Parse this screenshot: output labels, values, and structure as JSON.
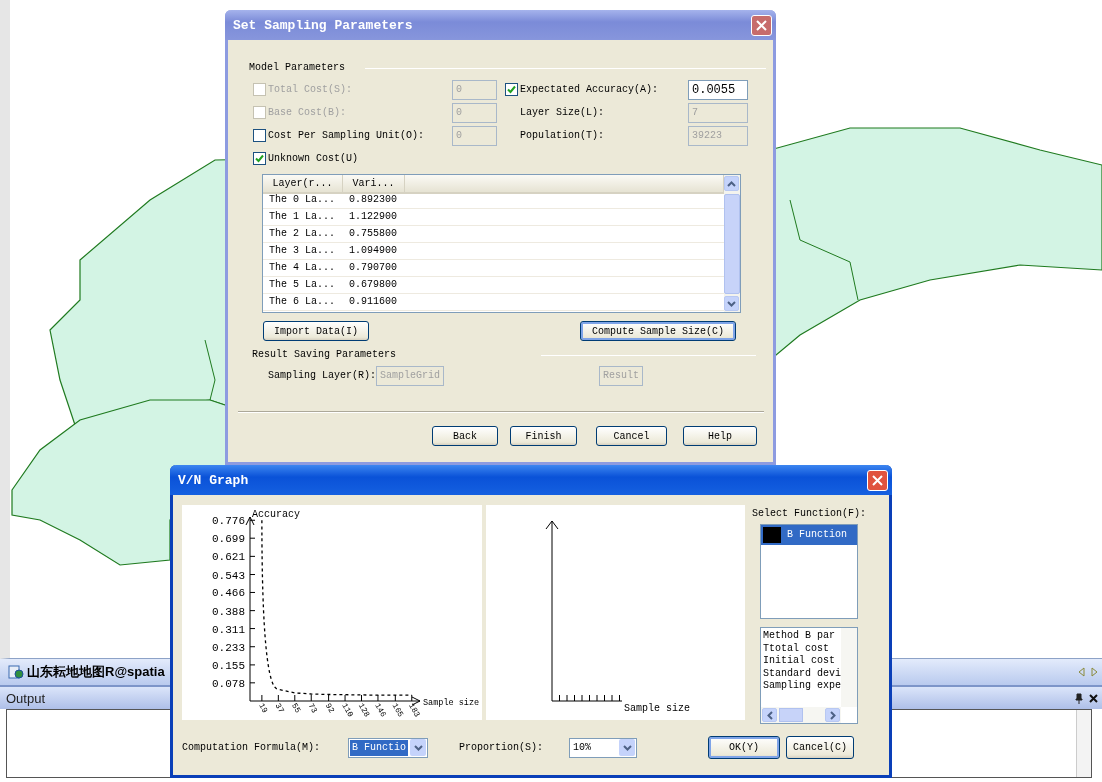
{
  "map_view": {
    "tab": {
      "label": "山东耘地地图R@spatia"
    }
  },
  "output_panel": {
    "title": "Output"
  },
  "sampling_dialog": {
    "title": "Set Sampling Parameters",
    "model_section": "Model Parameters",
    "left_options": [
      {
        "label": "Total Cost(S):",
        "checked": false,
        "disabled": true,
        "field": {
          "value": "0",
          "disabled": true
        }
      },
      {
        "label": "Base Cost(B):",
        "checked": false,
        "disabled": true,
        "field": {
          "value": "0",
          "disabled": true
        }
      },
      {
        "label": "Cost Per Sampling Unit(O):",
        "checked": false,
        "disabled": false,
        "field": {
          "value": "0",
          "disabled": true
        }
      },
      {
        "label": "Unknown Cost(U)",
        "checked": true,
        "disabled": false
      }
    ],
    "right_fields": [
      {
        "kind": "checkbox",
        "label": "Expectated Accuracy(A):",
        "checked": true,
        "value": "0.0055",
        "disabled": false
      },
      {
        "kind": "plain",
        "label": "Layer Size(L):",
        "value": "7",
        "disabled": true
      },
      {
        "kind": "plain",
        "label": "Population(T):",
        "value": "39223",
        "disabled": true
      }
    ],
    "table": {
      "columns": [
        "Layer(r...",
        "Vari..."
      ],
      "rows": [
        [
          "The 0 La...",
          "0.892300"
        ],
        [
          "The 1 La...",
          "1.122900"
        ],
        [
          "The 2 La...",
          "0.755800"
        ],
        [
          "The 3 La...",
          "1.094900"
        ],
        [
          "The 4 La...",
          "0.790700"
        ],
        [
          "The 5 La...",
          "0.679800"
        ],
        [
          "The 6 La...",
          "0.911600"
        ]
      ]
    },
    "import_button": "Import Data(I)",
    "compute_button": "Compute Sample Size(C)",
    "result_section": "Result Saving Parameters",
    "sampling_layer": {
      "label": "Sampling Layer(R):",
      "fields": [
        {
          "value": "SampleGrid",
          "disabled": true
        },
        {
          "value": "Result",
          "disabled": true
        }
      ]
    },
    "buttons": [
      "Back",
      "Finish",
      "Cancel",
      "Help"
    ]
  },
  "vn_dialog": {
    "title": "V/N Graph",
    "chart": {
      "chart_data": {
        "type": "line",
        "xlabel": "Sample size",
        "ylabel": "Accuracy",
        "x": [
          19,
          37,
          55,
          73,
          92,
          110,
          128,
          146,
          165,
          183
        ],
        "series": [
          {
            "color": "#000000",
            "line_style": "dashed",
            "values": [
              0.776,
              0.05,
              0.035,
              0.03,
              0.028,
              0.027,
              0.026,
              0.025,
              0.025,
              0.025
            ]
          }
        ],
        "xlim": [
          6,
          192
        ],
        "ylim": [
          0,
          0.79
        ],
        "xticks": [
          19,
          37,
          55,
          73,
          92,
          110,
          128,
          146,
          165,
          183
        ],
        "yticks": [
          {
            "value": 0.776,
            "label": "0.776"
          },
          {
            "value": 0.699,
            "label": "0.699"
          },
          {
            "value": 0.621,
            "label": "0.621"
          },
          {
            "value": 0.543,
            "label": "0.543"
          },
          {
            "value": 0.466,
            "label": "0.466"
          },
          {
            "value": 0.388,
            "label": "0.388"
          },
          {
            "value": 0.311,
            "label": "0.311"
          },
          {
            "value": 0.233,
            "label": "0.233"
          },
          {
            "value": 0.155,
            "label": "0.155"
          },
          {
            "value": 0.078,
            "label": "0.078"
          }
        ]
      }
    },
    "second_chart": {
      "xlabel": "Sample size"
    },
    "select_function": {
      "label": "Select Function(F):",
      "items": [
        {
          "label": "B Function",
          "color": "#000000",
          "selected": true
        }
      ]
    },
    "info_lines": [
      "Method B par",
      "Ttotal cost",
      "Initial cost",
      "Standard devi",
      "Sampling expe"
    ],
    "formula": {
      "label": "Computation Formula(M):",
      "value": "B Functio"
    },
    "proportion": {
      "label": "Proportion(S):",
      "value": "10%"
    },
    "buttons": [
      "OK(Y)",
      "Cancel(C)"
    ]
  }
}
